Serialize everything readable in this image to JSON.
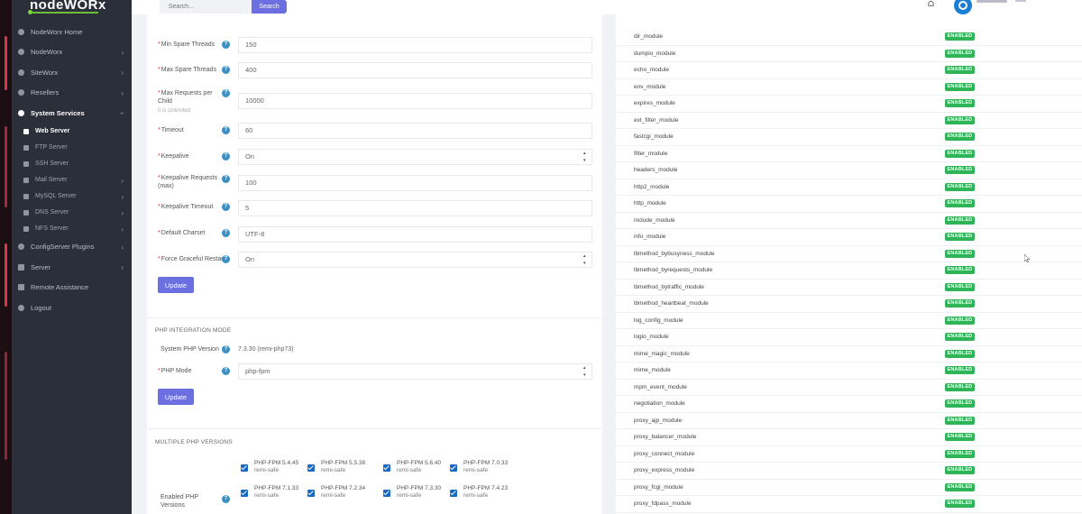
{
  "app": {
    "logo_text": "nodeWORx"
  },
  "topbar": {
    "search_placeholder": "Search...",
    "search_button": "Search"
  },
  "sidebar": {
    "items": [
      {
        "label": "NodeWorx Home"
      },
      {
        "label": "NodeWorx"
      },
      {
        "label": "SiteWorx"
      },
      {
        "label": "Resellers"
      },
      {
        "label": "System Services"
      }
    ],
    "sub_items": [
      {
        "label": "Web Server"
      },
      {
        "label": "FTP Server"
      },
      {
        "label": "SSH Server"
      },
      {
        "label": "Mail Server"
      },
      {
        "label": "MySQL Server"
      },
      {
        "label": "DNS Server"
      },
      {
        "label": "NFS Server"
      }
    ],
    "bottom_items": [
      {
        "label": "ConfigServer Plugins"
      },
      {
        "label": "Server"
      },
      {
        "label": "Remote Assistance"
      },
      {
        "label": "Logout"
      }
    ]
  },
  "form": {
    "rows": [
      {
        "label": "Min Spare Threads",
        "value": "150",
        "type": "text"
      },
      {
        "label": "Max Spare Threads",
        "value": "400",
        "type": "text"
      },
      {
        "label": "Max Requests per Child",
        "sub": "0 is Unlimited",
        "value": "10000",
        "type": "text"
      },
      {
        "label": "Timeout",
        "value": "60",
        "type": "text"
      },
      {
        "label": "Keepalive",
        "value": "On",
        "type": "select"
      },
      {
        "label": "Keepalive Requests (max)",
        "value": "100",
        "type": "text"
      },
      {
        "label": "Keepalive Timeout",
        "value": "5",
        "type": "text"
      },
      {
        "label": "Default Charset",
        "value": "UTF-8",
        "type": "text"
      },
      {
        "label": "Force Graceful Restart",
        "value": "On",
        "type": "select"
      }
    ],
    "update_label": "Update"
  },
  "php_integration": {
    "title": "PHP INTEGRATION MODE",
    "system_version_label": "System PHP Version",
    "system_version_value": "7.3.30 (remi-php73)",
    "mode_label": "PHP Mode",
    "mode_value": "php-fpm",
    "update_label": "Update"
  },
  "multiple_php": {
    "title": "MULTIPLE PHP VERSIONS",
    "enabled_label": "Enabled PHP Versions",
    "versions": [
      {
        "name": "PHP-FPM 5.4.45",
        "source": "remi-safe"
      },
      {
        "name": "PHP-FPM 5.5.38",
        "source": "remi-safe"
      },
      {
        "name": "PHP-FPM 5.6.40",
        "source": "remi-safe"
      },
      {
        "name": "PHP-FPM 7.0.33",
        "source": "remi-safe"
      },
      {
        "name": "PHP-FPM 7.1.33",
        "source": "remi-safe"
      },
      {
        "name": "PHP-FPM 7.2.34",
        "source": "remi-safe"
      },
      {
        "name": "PHP-FPM 7.3.30",
        "source": "remi-safe"
      },
      {
        "name": "PHP-FPM 7.4.23",
        "source": "remi-safe"
      }
    ]
  },
  "modules": {
    "status_label": "ENABLED",
    "items": [
      "dir_module",
      "dumpio_module",
      "echo_module",
      "env_module",
      "expires_module",
      "ext_filter_module",
      "fastcgi_module",
      "filter_module",
      "headers_module",
      "http2_module",
      "http_module",
      "include_module",
      "info_module",
      "lbmethod_bybusyness_module",
      "lbmethod_byrequests_module",
      "lbmethod_bytraffic_module",
      "lbmethod_heartbeat_module",
      "log_config_module",
      "logio_module",
      "mime_magic_module",
      "mime_module",
      "mpm_event_module",
      "negotiation_module",
      "proxy_ajp_module",
      "proxy_balancer_module",
      "proxy_connect_module",
      "proxy_express_module",
      "proxy_fcgi_module",
      "proxy_fdpass_module"
    ]
  },
  "colors": {
    "accent": "#6b6fe0",
    "enabled": "#2fb457",
    "sidebar": "#2b2f3a",
    "help": "#3d8fc4"
  }
}
